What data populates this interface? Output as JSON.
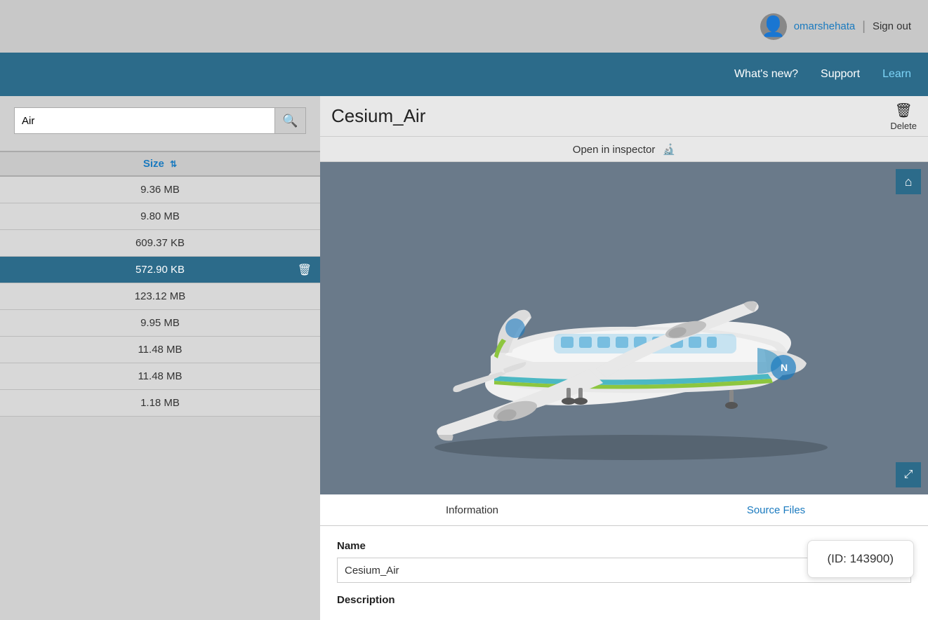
{
  "header": {
    "username": "omarshehata",
    "sign_out_label": "Sign out"
  },
  "nav": {
    "items": [
      {
        "label": "What's new?"
      },
      {
        "label": "Support"
      },
      {
        "label": "Learn"
      }
    ]
  },
  "sidebar": {
    "search_value": "Air",
    "search_placeholder": "Search...",
    "search_btn_label": "🔍",
    "size_column_label": "Size",
    "rows": [
      {
        "size": "9.36 MB",
        "selected": false
      },
      {
        "size": "9.80 MB",
        "selected": false
      },
      {
        "size": "609.37 KB",
        "selected": false
      },
      {
        "size": "572.90 KB",
        "selected": true
      },
      {
        "size": "123.12 MB",
        "selected": false
      },
      {
        "size": "9.95 MB",
        "selected": false
      },
      {
        "size": "11.48 MB",
        "selected": false
      },
      {
        "size": "11.48 MB",
        "selected": false
      },
      {
        "size": "1.18 MB",
        "selected": false
      }
    ]
  },
  "content": {
    "asset_title": "Cesium_Air",
    "delete_label": "Delete",
    "inspector_label": "Open in inspector",
    "inspector_icon": "🔬",
    "home_btn_icon": "⌂",
    "expand_btn_icon": "⤢",
    "tabs": [
      {
        "label": "Information",
        "active": true
      },
      {
        "label": "Source Files",
        "active": false
      }
    ],
    "name_field_label": "Name",
    "name_field_value": "Cesium_Air",
    "description_label": "Description",
    "id_tooltip": "(ID:   143900)"
  },
  "colors": {
    "accent": "#2c6b8a",
    "link": "#1a7abf",
    "selected_row_bg": "#2c6b8a",
    "nav_bg": "#2c6b8a"
  }
}
